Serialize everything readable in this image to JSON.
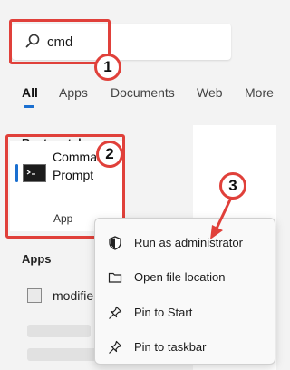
{
  "search": {
    "query": "cmd"
  },
  "tabs": [
    "All",
    "Apps",
    "Documents",
    "Web",
    "More"
  ],
  "best_match": {
    "heading": "Best match",
    "title": "Command Prompt",
    "subtitle": "App"
  },
  "apps_section": {
    "heading": "Apps",
    "item": "modifie"
  },
  "context_menu": [
    {
      "label": "Run as administrator",
      "icon": "shield-icon"
    },
    {
      "label": "Open file location",
      "icon": "folder-icon"
    },
    {
      "label": "Pin to Start",
      "icon": "pin-icon"
    },
    {
      "label": "Pin to taskbar",
      "icon": "pin-icon"
    }
  ],
  "callouts": [
    "1",
    "2",
    "3"
  ],
  "colors": {
    "accent": "#1a6fd0",
    "callout": "#e0403a"
  }
}
